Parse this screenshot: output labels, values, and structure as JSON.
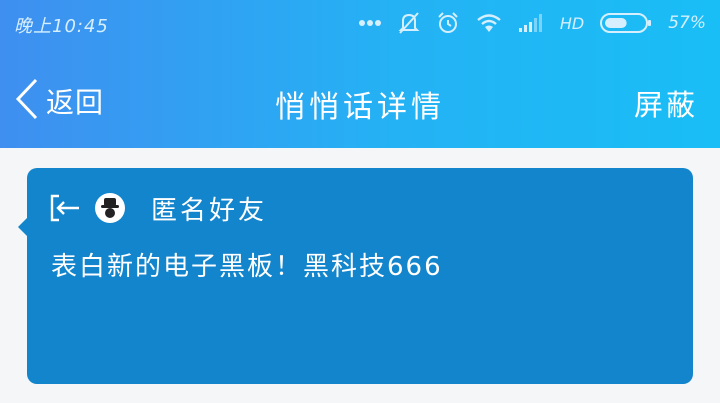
{
  "status_bar": {
    "time": "晚上10:45",
    "network_label": "HD",
    "battery_percent": "57%",
    "battery_level": 0.57,
    "icons": [
      "more-dots-icon",
      "mute-icon",
      "alarm-icon",
      "wifi-icon",
      "signal-icon",
      "battery-icon"
    ]
  },
  "nav": {
    "back_label": "返回",
    "title": "悄悄话详情",
    "block_label": "屏蔽"
  },
  "message": {
    "sender": "匿名好友",
    "text": "表白新的电子黑板！黑科技666"
  },
  "colors": {
    "gradient_start": "#3f8ff0",
    "gradient_end": "#19bef6",
    "card": "#1385cc",
    "background": "#f4f6f8"
  }
}
